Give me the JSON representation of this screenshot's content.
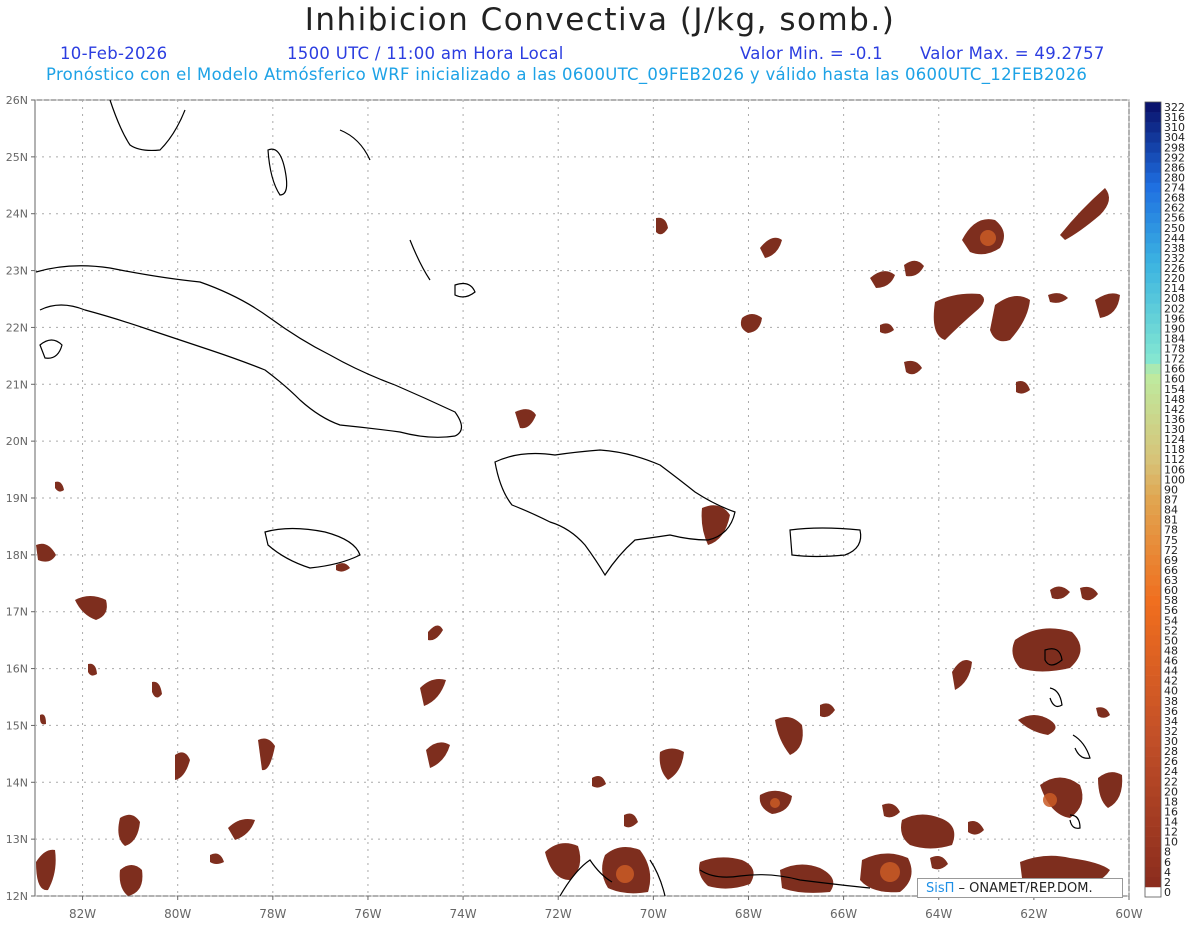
{
  "header": {
    "title": "Inhibicion Convectiva (J/kg, somb.)",
    "date": "10-Feb-2026",
    "time": "1500 UTC / 11:00 am Hora Local",
    "value_min": "Valor Min. = -0.1",
    "value_max": "Valor Max. = 49.2757",
    "model_note": "Pronóstico con el Modelo Atmósferico WRF inicializado a las 0600UTC_09FEB2026 y válido hasta las  0600UTC_12FEB2026"
  },
  "map": {
    "lon_range": [
      -83,
      -60
    ],
    "lat_range": [
      12,
      26
    ],
    "lon_ticks": [
      "82W",
      "80W",
      "78W",
      "76W",
      "74W",
      "72W",
      "70W",
      "68W",
      "66W",
      "64W",
      "62W",
      "60W"
    ],
    "lat_ticks": [
      "12N",
      "13N",
      "14N",
      "15N",
      "16N",
      "17N",
      "18N",
      "19N",
      "20N",
      "21N",
      "22N",
      "23N",
      "24N",
      "25N",
      "26N"
    ],
    "fill_color": "#7e2e1e",
    "highlight_color": "#c95a26",
    "coast_color": "#000000",
    "grid": true
  },
  "colorbar": {
    "labels": [
      "0",
      "2",
      "4",
      "6",
      "8",
      "10",
      "12",
      "14",
      "16",
      "18",
      "20",
      "22",
      "24",
      "26",
      "28",
      "30",
      "32",
      "34",
      "36",
      "38",
      "40",
      "42",
      "44",
      "46",
      "48",
      "50",
      "52",
      "54",
      "56",
      "58",
      "60",
      "63",
      "66",
      "69",
      "72",
      "75",
      "78",
      "81",
      "84",
      "87",
      "90",
      "100",
      "106",
      "112",
      "118",
      "124",
      "130",
      "136",
      "142",
      "148",
      "154",
      "160",
      "166",
      "172",
      "178",
      "184",
      "190",
      "196",
      "202",
      "208",
      "214",
      "220",
      "226",
      "232",
      "238",
      "244",
      "250",
      "256",
      "262",
      "268",
      "274",
      "280",
      "286",
      "292",
      "298",
      "304",
      "310",
      "316",
      "322"
    ]
  },
  "credit": {
    "brand": "SisΠ",
    "org": " – ONAMET/REP.DOM."
  }
}
